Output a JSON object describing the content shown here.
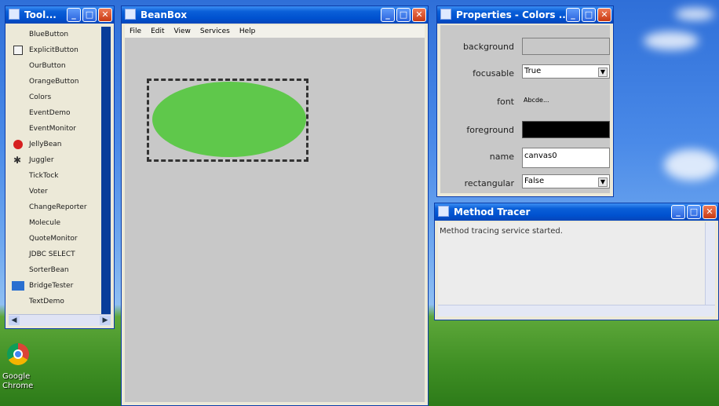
{
  "colors": {
    "accent": "#0051cf",
    "canvas_bg": "#c8c8c8",
    "ellipse_fill": "#5fc84b",
    "foreground_swatch": "#000000"
  },
  "toolbox": {
    "title": "Tool...",
    "items": [
      {
        "label": "BlueButton",
        "icon": ""
      },
      {
        "label": "ExplicitButton",
        "icon": "button-bean-icon"
      },
      {
        "label": "OurButton",
        "icon": ""
      },
      {
        "label": "OrangeButton",
        "icon": ""
      },
      {
        "label": "Colors",
        "icon": ""
      },
      {
        "label": "EventDemo",
        "icon": ""
      },
      {
        "label": "EventMonitor",
        "icon": ""
      },
      {
        "label": "JellyBean",
        "icon": "jellybean-icon"
      },
      {
        "label": "Juggler",
        "icon": "juggler-icon"
      },
      {
        "label": "TickTock",
        "icon": ""
      },
      {
        "label": "Voter",
        "icon": ""
      },
      {
        "label": "ChangeReporter",
        "icon": ""
      },
      {
        "label": "Molecule",
        "icon": ""
      },
      {
        "label": "QuoteMonitor",
        "icon": ""
      },
      {
        "label": "JDBC SELECT",
        "icon": ""
      },
      {
        "label": "SorterBean",
        "icon": ""
      },
      {
        "label": "BridgeTester",
        "icon": "bridge-icon"
      },
      {
        "label": "TextDemo",
        "icon": ""
      }
    ]
  },
  "beanbox": {
    "title": "BeanBox",
    "menu": [
      "File",
      "Edit",
      "View",
      "Services",
      "Help"
    ]
  },
  "properties": {
    "title": "Properties - Colors ...",
    "rows": [
      {
        "label": "background",
        "value": "",
        "kind": "color-empty"
      },
      {
        "label": "focusable",
        "value": "True",
        "kind": "select"
      },
      {
        "label": "font",
        "value": "Abcde...",
        "kind": "text"
      },
      {
        "label": "foreground",
        "value": "",
        "kind": "color-black"
      },
      {
        "label": "name",
        "value": "canvas0",
        "kind": "input"
      },
      {
        "label": "rectangular",
        "value": "False",
        "kind": "select"
      }
    ]
  },
  "tracer": {
    "title": "Method Tracer",
    "message": "Method tracing service started."
  },
  "desktop": {
    "chrome_label_1": "Google",
    "chrome_label_2": "Chrome"
  }
}
